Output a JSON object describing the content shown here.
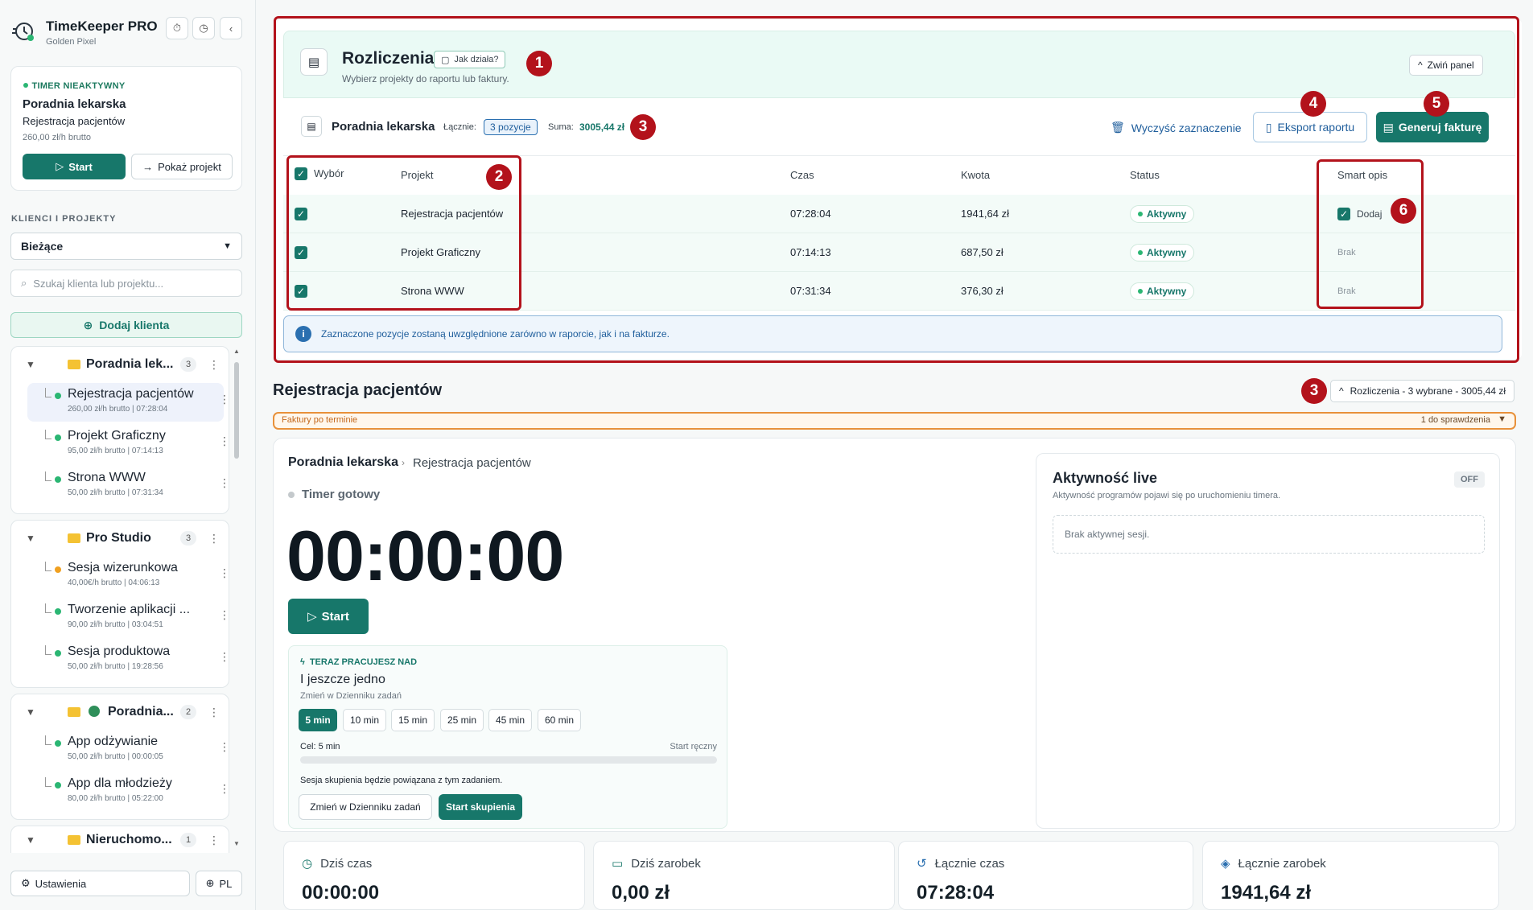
{
  "app": {
    "title": "TimeKeeper PRO",
    "subtitle": "Golden Pixel"
  },
  "sidebar": {
    "timer_card": {
      "status": "TIMER NIEAKTYWNY",
      "client": "Poradnia lekarska",
      "project": "Rejestracja pacjentów",
      "rate": "260,00 zł/h brutto",
      "start_label": "Start",
      "show_project_label": "Pokaż projekt"
    },
    "section_label": "KLIENCI I PROJEKTY",
    "filter_value": "Bieżące",
    "search_placeholder": "Szukaj klienta lub projektu...",
    "add_client_label": "Dodaj klienta",
    "groups": [
      {
        "name": "Poradnia lek...",
        "count": "3",
        "items": [
          {
            "name": "Rejestracja pacjentów",
            "meta": "260,00 zł/h brutto | 07:28:04",
            "color": "#2bb673"
          },
          {
            "name": "Projekt Graficzny",
            "meta": "95,00 zł/h brutto | 07:14:13",
            "color": "#2bb673"
          },
          {
            "name": "Strona WWW",
            "meta": "50,00 zł/h brutto | 07:31:34",
            "color": "#2bb673"
          }
        ]
      },
      {
        "name": "Pro Studio",
        "count": "3",
        "items": [
          {
            "name": "Sesja wizerunkowa",
            "meta": "40,00€/h brutto | 04:06:13",
            "color": "#f0a020"
          },
          {
            "name": "Tworzenie aplikacji ...",
            "meta": "90,00 zł/h brutto | 03:04:51",
            "color": "#2bb673"
          },
          {
            "name": "Sesja produktowa",
            "meta": "50,00 zł/h brutto | 19:28:56",
            "color": "#2bb673"
          }
        ]
      },
      {
        "name": "Poradnia...",
        "count": "2",
        "items": [
          {
            "name": "App odżywianie",
            "meta": "50,00 zł/h brutto | 00:00:05",
            "color": "#2bb673"
          },
          {
            "name": "App dla młodzieży",
            "meta": "80,00 zł/h brutto | 05:22:00",
            "color": "#2bb673"
          }
        ]
      },
      {
        "name": "Nieruchomo...",
        "count": "1",
        "items": []
      }
    ],
    "settings_label": "Ustawienia",
    "lang_label": "PL"
  },
  "rozliczenia": {
    "title": "Rozliczenia",
    "how_label": "Jak działa?",
    "subtitle": "Wybierz projekty do raportu lub faktury.",
    "collapse_label": "Zwiń panel",
    "client": "Poradnia lekarska",
    "total_label": "Łącznie:",
    "total_value": "3 pozycje",
    "sum_label": "Suma:",
    "sum_value": "3005,44 zł",
    "clear_label": "Wyczyść zaznaczenie",
    "export_label": "Eksport raportu",
    "invoice_label": "Generuj fakturę",
    "columns": [
      "Wybór",
      "Projekt",
      "Czas",
      "Kwota",
      "Status",
      "Smart opis"
    ],
    "rows": [
      {
        "project": "Rejestracja pacjentów",
        "time": "07:28:04",
        "amount": "1941,64 zł",
        "status": "Aktywny",
        "smart": "Dodaj"
      },
      {
        "project": "Projekt Graficzny",
        "time": "07:14:13",
        "amount": "687,50 zł",
        "status": "Aktywny",
        "smart": "Brak"
      },
      {
        "project": "Strona WWW",
        "time": "07:31:34",
        "amount": "376,30 zł",
        "status": "Aktywny",
        "smart": "Brak"
      }
    ],
    "info": "Zaznaczone pozycje zostaną uwzględnione zarówno w raporcie, jak i na fakturze."
  },
  "badges": [
    "1",
    "2",
    "3",
    "4",
    "5",
    "6",
    "3"
  ],
  "project_view": {
    "title": "Rejestracja pacjentów",
    "rozliczenia_chip": "Rozliczenia - 3 wybrane - 3005,44 zł",
    "overdue_label": "Faktury po terminie",
    "overdue_count": "1 do sprawdzenia",
    "breadcrumb_client": "Poradnia lekarska",
    "breadcrumb_project": "Rejestracja pacjentów",
    "timer_status": "Timer gotowy",
    "timer_value": "00:00:00",
    "start_label": "Start",
    "focus": {
      "header": "TERAZ PRACUJESZ NAD",
      "task": "I jeszcze jedno",
      "change_link": "Zmień w Dzienniku zadań",
      "chips": [
        "5 min",
        "10 min",
        "15 min",
        "25 min",
        "45 min",
        "60 min"
      ],
      "goal": "Cel: 5 min",
      "mode": "Start ręczny",
      "progress": 0,
      "note": "Sesja skupienia będzie powiązana z tym zadaniem.",
      "change_btn": "Zmień w Dzienniku zadań",
      "start_btn": "Start skupienia"
    },
    "live": {
      "title": "Aktywność live",
      "badge": "OFF",
      "subtitle": "Aktywność programów pojawi się po uruchomieniu timera.",
      "empty": "Brak aktywnej sesji."
    }
  },
  "stats": [
    {
      "label": "Dziś czas",
      "value": "00:00:00"
    },
    {
      "label": "Dziś zarobek",
      "value": "0,00 zł"
    },
    {
      "label": "Łącznie czas",
      "value": "07:28:04"
    },
    {
      "label": "Łącznie zarobek",
      "value": "1941,64 zł"
    }
  ],
  "colors": {
    "accent": "#17776a",
    "annotation": "#b3121b",
    "overdue": "#e8913a"
  }
}
